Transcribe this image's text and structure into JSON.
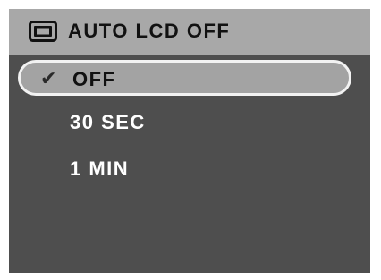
{
  "menu": {
    "icon": "lcd-screen-icon",
    "title": "AUTO LCD OFF",
    "options": [
      {
        "label": "OFF",
        "selected": true,
        "check": "✔"
      },
      {
        "label": "30 SEC",
        "selected": false
      },
      {
        "label": "1 MIN",
        "selected": false
      }
    ]
  },
  "colors": {
    "background": "#4e4e4e",
    "header": "#a8a8a8",
    "highlight": "#a3a3a3",
    "highlight_border": "#f2f2f2"
  }
}
